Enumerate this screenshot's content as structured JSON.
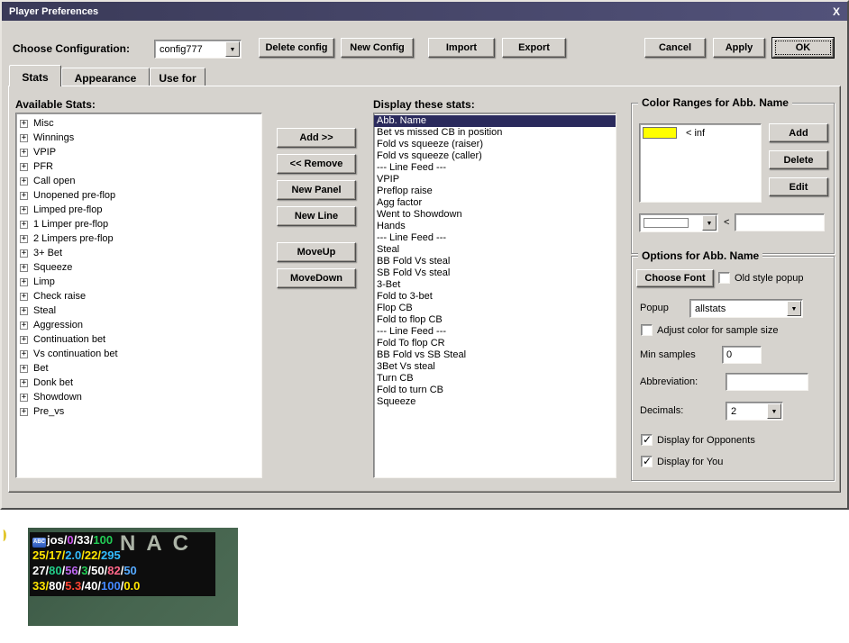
{
  "window": {
    "title": "Player Preferences",
    "close_label": "X"
  },
  "toolbar": {
    "config_label": "Choose Configuration:",
    "config_value": "config777",
    "delete_config": "Delete config",
    "new_config": "New Config",
    "import": "Import",
    "export": "Export",
    "cancel": "Cancel",
    "apply": "Apply",
    "ok": "OK"
  },
  "tabs": [
    {
      "label": "Stats"
    },
    {
      "label": "Appearance"
    },
    {
      "label": "Use for"
    }
  ],
  "available_stats": {
    "label": "Available Stats:",
    "items": [
      "Misc",
      "Winnings",
      "VPIP",
      "PFR",
      "Call open",
      "Unopened pre-flop",
      "Limped pre-flop",
      "1 Limper pre-flop",
      "2 Limpers pre-flop",
      "3+ Bet",
      "Squeeze",
      "Limp",
      "Check raise",
      "Steal",
      "Aggression",
      "Continuation bet",
      "Vs continuation bet",
      "Bet",
      "Donk bet",
      "Showdown",
      "Pre_vs"
    ]
  },
  "actions": {
    "add": "Add >>",
    "remove": "<< Remove",
    "new_panel": "New Panel",
    "new_line": "New Line",
    "move_up": "MoveUp",
    "move_down": "MoveDown"
  },
  "display_stats": {
    "label": "Display these stats:",
    "selected_index": 0,
    "items": [
      "Abb. Name",
      "Bet vs missed CB in position",
      "Fold vs squeeze (raiser)",
      "Fold vs squeeze (caller)",
      "--- Line Feed ---",
      "VPIP",
      "Preflop raise",
      "Agg factor",
      "Went to Showdown",
      "Hands",
      "--- Line Feed ---",
      "Steal",
      "BB Fold Vs steal",
      "SB Fold Vs steal",
      "3-Bet",
      "Fold to 3-bet",
      "Flop CB",
      "Fold to flop CB",
      "--- Line Feed ---",
      "Fold To flop CR",
      "BB Fold vs SB Steal",
      "3Bet Vs steal",
      "Turn CB",
      "Fold to turn CB",
      "Squeeze"
    ]
  },
  "color_ranges": {
    "title": "Color Ranges for Abb. Name",
    "swatch_color": "#ffff00",
    "range_label": "< inf",
    "add": "Add",
    "delete": "Delete",
    "edit": "Edit",
    "less_than": "<",
    "threshold_value": ""
  },
  "options": {
    "title": "Options for Abb. Name",
    "choose_font": "Choose Font",
    "old_style_popup": "Old style popup",
    "old_style_popup_checked": false,
    "popup_label": "Popup",
    "popup_value": "allstats",
    "adjust_color": "Adjust color for sample size",
    "adjust_color_checked": false,
    "min_samples_label": "Min samples",
    "min_samples_value": "0",
    "abbreviation_label": "Abbreviation:",
    "abbreviation_value": "",
    "decimals_label": "Decimals:",
    "decimals_value": "2",
    "display_opponents": "Display for Opponents",
    "display_opponents_checked": true,
    "display_you": "Display for You",
    "display_you_checked": true
  },
  "hud_preview": {
    "table_text": "NAC",
    "lines": [
      {
        "icon": "ABC",
        "segments": [
          [
            "jos",
            "#ffffff"
          ],
          [
            "/",
            "#ffffff"
          ],
          [
            "0",
            "#cc55ee"
          ],
          [
            "/",
            "#ffffff"
          ],
          [
            "33",
            "#ffffff"
          ],
          [
            "/",
            "#ffffff"
          ],
          [
            "100",
            "#22cc55"
          ]
        ]
      },
      {
        "segments": [
          [
            "25",
            "#ffe400"
          ],
          [
            "/",
            "#ffe400"
          ],
          [
            "17",
            "#ffe400"
          ],
          [
            "/",
            "#ffe400"
          ],
          [
            "2.0",
            "#33bbff"
          ],
          [
            "/",
            "#ffe400"
          ],
          [
            "22",
            "#ffe400"
          ],
          [
            "/",
            "#ffe400"
          ],
          [
            "295",
            "#33bbff"
          ]
        ]
      },
      {
        "segments": [
          [
            "27",
            "#ffffff"
          ],
          [
            "/",
            "#ffffff"
          ],
          [
            "80",
            "#22cc88"
          ],
          [
            "/",
            "#ffffff"
          ],
          [
            "56",
            "#bb66ee"
          ],
          [
            "/",
            "#ffffff"
          ],
          [
            "3",
            "#22cc55"
          ],
          [
            "/",
            "#ffffff"
          ],
          [
            "50",
            "#ffffff"
          ],
          [
            "/",
            "#ffffff"
          ],
          [
            "82",
            "#ff6688"
          ],
          [
            "/",
            "#ffffff"
          ],
          [
            "50",
            "#55aaff"
          ]
        ]
      },
      {
        "segments": [
          [
            "33",
            "#ffe400"
          ],
          [
            "/",
            "#ffe400"
          ],
          [
            "80",
            "#ffffff"
          ],
          [
            "/",
            "#ffffff"
          ],
          [
            "5.3",
            "#ff4433"
          ],
          [
            "/",
            "#ffffff"
          ],
          [
            "40",
            "#ffffff"
          ],
          [
            "/",
            "#ffffff"
          ],
          [
            "100",
            "#4488ff"
          ],
          [
            "/",
            "#ffffff"
          ],
          [
            "0.0",
            "#ffe400"
          ]
        ]
      }
    ]
  }
}
